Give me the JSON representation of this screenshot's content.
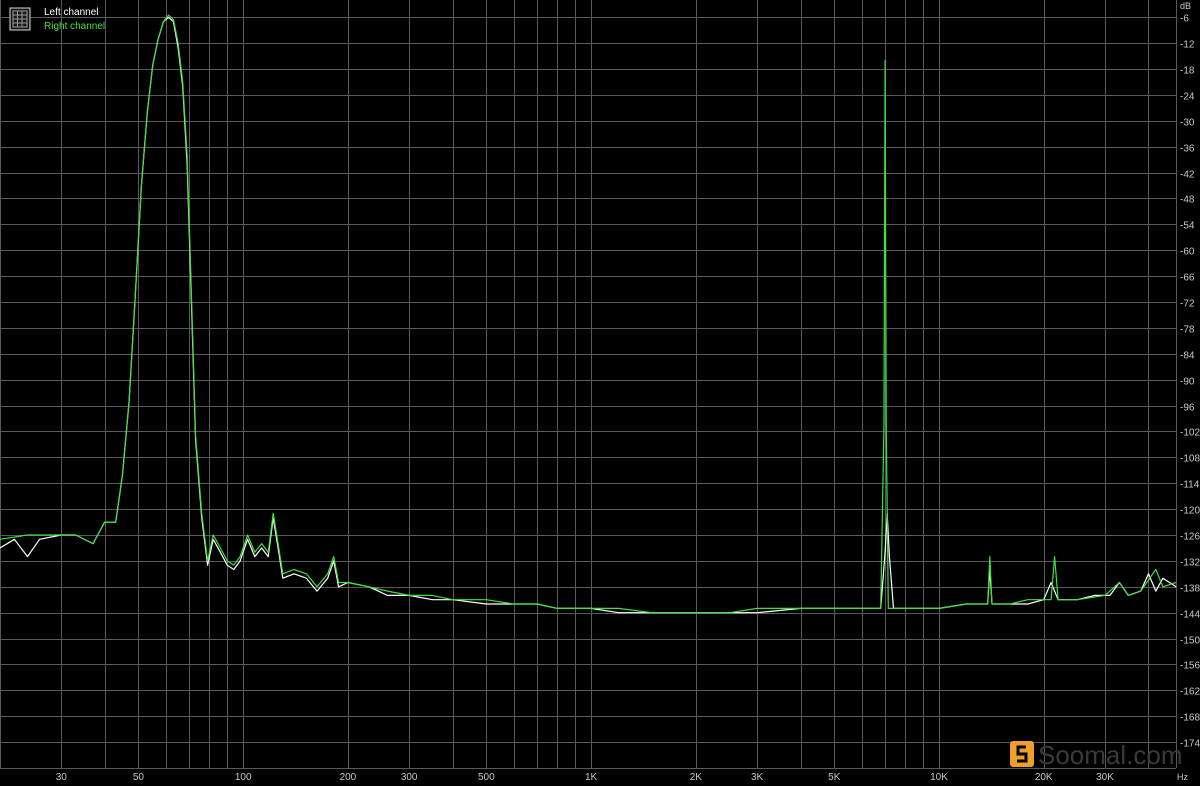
{
  "legend": {
    "items": [
      {
        "label": "Left channel",
        "color": "#ffffff"
      },
      {
        "label": "Right channel",
        "color": "#3fe03f"
      }
    ]
  },
  "icons": {
    "legend_toggle": "grid-icon"
  },
  "watermark": {
    "text": "Soomal.com",
    "logo_color": "#f0a028"
  },
  "colors": {
    "background": "#000000",
    "grid": "#5a5a5a",
    "axis_text": "#c8c8c8"
  },
  "chart_data": {
    "type": "line",
    "title": "",
    "xlabel": "Hz",
    "ylabel": "dB",
    "x_scale": "log",
    "xlim": [
      20,
      48000
    ],
    "ylim": [
      -180,
      -2
    ],
    "grid": true,
    "legend_position": "top-left",
    "x_tick_labels": [
      {
        "value": 30,
        "label": "30"
      },
      {
        "value": 50,
        "label": "50"
      },
      {
        "value": 100,
        "label": "100"
      },
      {
        "value": 200,
        "label": "200"
      },
      {
        "value": 300,
        "label": "300"
      },
      {
        "value": 500,
        "label": "500"
      },
      {
        "value": 1000,
        "label": "1K"
      },
      {
        "value": 2000,
        "label": "2K"
      },
      {
        "value": 3000,
        "label": "3K"
      },
      {
        "value": 5000,
        "label": "5K"
      },
      {
        "value": 10000,
        "label": "10K"
      },
      {
        "value": 20000,
        "label": "20K"
      },
      {
        "value": 30000,
        "label": "30K"
      }
    ],
    "y_ticks": [
      -6,
      -12,
      -18,
      -24,
      -30,
      -36,
      -42,
      -48,
      -54,
      -60,
      -66,
      -72,
      -78,
      -84,
      -90,
      -96,
      -102,
      -108,
      -114,
      -120,
      -126,
      -132,
      -138,
      -144,
      -150,
      -156,
      -162,
      -168,
      -174
    ],
    "series": [
      {
        "name": "Left channel",
        "color": "#ffffff",
        "points": [
          [
            20,
            -129
          ],
          [
            22,
            -127
          ],
          [
            24,
            -131
          ],
          [
            26,
            -127
          ],
          [
            30,
            -126
          ],
          [
            33,
            -126
          ],
          [
            37,
            -128
          ],
          [
            40,
            -123
          ],
          [
            43,
            -123
          ],
          [
            45,
            -112
          ],
          [
            47,
            -95
          ],
          [
            49,
            -70
          ],
          [
            51,
            -45
          ],
          [
            53,
            -28
          ],
          [
            55,
            -17
          ],
          [
            57,
            -11
          ],
          [
            59,
            -7
          ],
          [
            61,
            -6
          ],
          [
            63,
            -7
          ],
          [
            65,
            -13
          ],
          [
            67,
            -22
          ],
          [
            69,
            -40
          ],
          [
            71,
            -72
          ],
          [
            73,
            -104
          ],
          [
            76,
            -122
          ],
          [
            79,
            -133
          ],
          [
            82,
            -127
          ],
          [
            86,
            -130
          ],
          [
            90,
            -133
          ],
          [
            94,
            -134
          ],
          [
            98,
            -132
          ],
          [
            103,
            -127
          ],
          [
            108,
            -131
          ],
          [
            113,
            -129
          ],
          [
            118,
            -131
          ],
          [
            122,
            -122
          ],
          [
            126,
            -129
          ],
          [
            130,
            -136
          ],
          [
            140,
            -135
          ],
          [
            152,
            -136
          ],
          [
            163,
            -139
          ],
          [
            175,
            -136
          ],
          [
            182,
            -132
          ],
          [
            188,
            -138
          ],
          [
            200,
            -137
          ],
          [
            230,
            -138
          ],
          [
            260,
            -140
          ],
          [
            300,
            -140
          ],
          [
            350,
            -141
          ],
          [
            400,
            -141
          ],
          [
            500,
            -142
          ],
          [
            600,
            -142
          ],
          [
            700,
            -142
          ],
          [
            800,
            -143
          ],
          [
            1000,
            -143
          ],
          [
            1200,
            -144
          ],
          [
            1500,
            -144
          ],
          [
            2000,
            -144
          ],
          [
            2500,
            -144
          ],
          [
            3000,
            -144
          ],
          [
            4000,
            -143
          ],
          [
            5000,
            -143
          ],
          [
            6000,
            -143
          ],
          [
            6800,
            -143
          ],
          [
            7000,
            -130
          ],
          [
            7100,
            -121
          ],
          [
            7200,
            -131
          ],
          [
            7400,
            -143
          ],
          [
            8000,
            -143
          ],
          [
            10000,
            -143
          ],
          [
            12000,
            -142
          ],
          [
            13800,
            -142
          ],
          [
            14000,
            -134
          ],
          [
            14200,
            -142
          ],
          [
            16000,
            -142
          ],
          [
            18000,
            -142
          ],
          [
            20000,
            -141
          ],
          [
            21000,
            -137
          ],
          [
            22000,
            -141
          ],
          [
            25000,
            -141
          ],
          [
            28000,
            -140
          ],
          [
            31000,
            -140
          ],
          [
            33000,
            -137
          ],
          [
            35000,
            -140
          ],
          [
            38000,
            -139
          ],
          [
            40000,
            -135
          ],
          [
            42000,
            -139
          ],
          [
            44000,
            -136
          ],
          [
            48000,
            -138
          ]
        ]
      },
      {
        "name": "Right channel",
        "color": "#3fe03f",
        "points": [
          [
            20,
            -127
          ],
          [
            24,
            -126
          ],
          [
            28,
            -126
          ],
          [
            30,
            -126
          ],
          [
            33,
            -126
          ],
          [
            37,
            -128
          ],
          [
            40,
            -123
          ],
          [
            43,
            -123
          ],
          [
            45,
            -112
          ],
          [
            47,
            -95
          ],
          [
            49,
            -70
          ],
          [
            51,
            -45
          ],
          [
            53,
            -28
          ],
          [
            55,
            -17
          ],
          [
            57,
            -11
          ],
          [
            59,
            -7
          ],
          [
            61,
            -5.5
          ],
          [
            63,
            -6.5
          ],
          [
            65,
            -12
          ],
          [
            67,
            -21
          ],
          [
            69,
            -38
          ],
          [
            71,
            -70
          ],
          [
            73,
            -103
          ],
          [
            76,
            -121
          ],
          [
            79,
            -132
          ],
          [
            82,
            -126
          ],
          [
            86,
            -129
          ],
          [
            90,
            -132
          ],
          [
            94,
            -133
          ],
          [
            98,
            -131
          ],
          [
            103,
            -126
          ],
          [
            108,
            -130
          ],
          [
            113,
            -128
          ],
          [
            118,
            -130
          ],
          [
            122,
            -121
          ],
          [
            126,
            -128
          ],
          [
            130,
            -135
          ],
          [
            140,
            -134
          ],
          [
            152,
            -135
          ],
          [
            163,
            -138
          ],
          [
            175,
            -135
          ],
          [
            182,
            -131
          ],
          [
            188,
            -137
          ],
          [
            200,
            -137
          ],
          [
            230,
            -138
          ],
          [
            260,
            -139
          ],
          [
            300,
            -140
          ],
          [
            350,
            -140
          ],
          [
            400,
            -141
          ],
          [
            500,
            -141
          ],
          [
            600,
            -142
          ],
          [
            700,
            -142
          ],
          [
            800,
            -143
          ],
          [
            1000,
            -143
          ],
          [
            1200,
            -143
          ],
          [
            1500,
            -144
          ],
          [
            2000,
            -144
          ],
          [
            2500,
            -144
          ],
          [
            3000,
            -143
          ],
          [
            4000,
            -143
          ],
          [
            5000,
            -143
          ],
          [
            6000,
            -143
          ],
          [
            6800,
            -143
          ],
          [
            6950,
            -100
          ],
          [
            7000,
            -16
          ],
          [
            7050,
            -100
          ],
          [
            7150,
            -143
          ],
          [
            8000,
            -143
          ],
          [
            10000,
            -143
          ],
          [
            12000,
            -142
          ],
          [
            13800,
            -142
          ],
          [
            14000,
            -131
          ],
          [
            14200,
            -142
          ],
          [
            16000,
            -142
          ],
          [
            18000,
            -141
          ],
          [
            21000,
            -141
          ],
          [
            21500,
            -131
          ],
          [
            22000,
            -141
          ],
          [
            25000,
            -141
          ],
          [
            30000,
            -140
          ],
          [
            33000,
            -137
          ],
          [
            35000,
            -140
          ],
          [
            38000,
            -139
          ],
          [
            42000,
            -134
          ],
          [
            44000,
            -138
          ],
          [
            48000,
            -137
          ]
        ]
      }
    ]
  }
}
